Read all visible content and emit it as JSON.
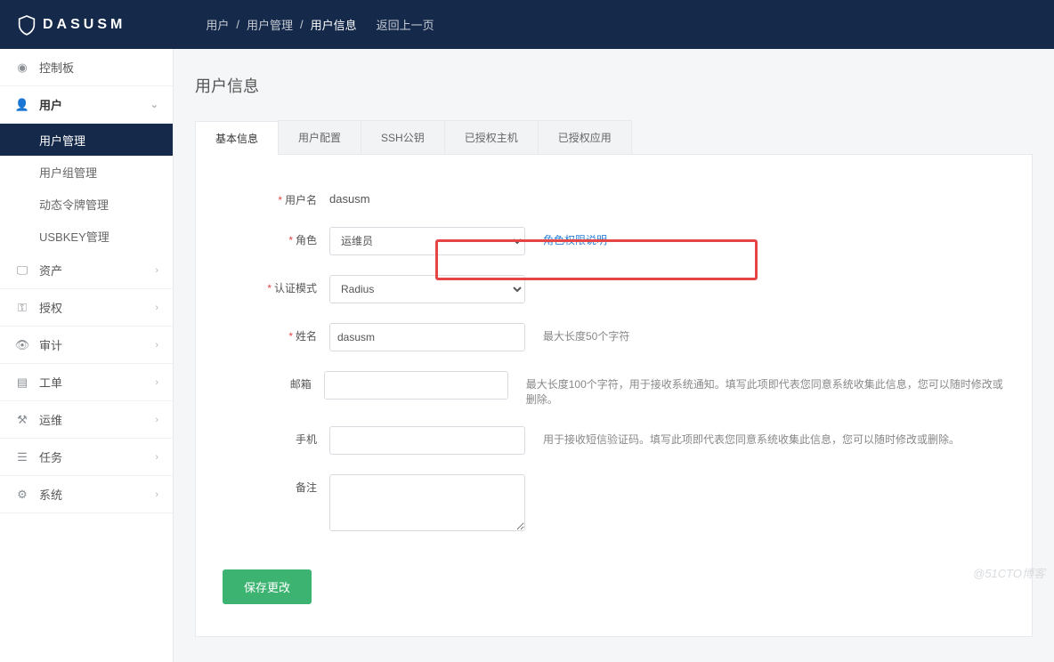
{
  "brand": "DASUSM",
  "breadcrumb": {
    "lvl1": "用户",
    "lvl2": "用户管理",
    "lvl3": "用户信息",
    "back": "返回上一页",
    "sep": "/"
  },
  "sidebar": {
    "items": [
      {
        "label": "控制板",
        "icon": "dashboard"
      },
      {
        "label": "用户",
        "icon": "user",
        "expanded": true,
        "chev": "⌄",
        "children": [
          {
            "label": "用户管理",
            "active": true
          },
          {
            "label": "用户组管理"
          },
          {
            "label": "动态令牌管理"
          },
          {
            "label": "USBKEY管理"
          }
        ]
      },
      {
        "label": "资产",
        "icon": "monitor",
        "chev": "›"
      },
      {
        "label": "授权",
        "icon": "key",
        "chev": "›"
      },
      {
        "label": "审计",
        "icon": "eye",
        "chev": "›"
      },
      {
        "label": "工单",
        "icon": "file",
        "chev": "›"
      },
      {
        "label": "运维",
        "icon": "ops",
        "chev": "›"
      },
      {
        "label": "任务",
        "icon": "task",
        "chev": "›"
      },
      {
        "label": "系统",
        "icon": "gear",
        "chev": "›"
      }
    ]
  },
  "page": {
    "title": "用户信息"
  },
  "tabs": [
    "基本信息",
    "用户配置",
    "SSH公钥",
    "已授权主机",
    "已授权应用"
  ],
  "form": {
    "username": {
      "label": "用户名",
      "value": "dasusm"
    },
    "role": {
      "label": "角色",
      "value": "运维员",
      "link": "角色权限说明"
    },
    "authmode": {
      "label": "认证模式",
      "value": "Radius"
    },
    "realname": {
      "label": "姓名",
      "value": "dasusm",
      "hint": "最大长度50个字符"
    },
    "email": {
      "label": "邮箱",
      "value": "",
      "hint": "最大长度100个字符，用于接收系统通知。填写此项即代表您同意系统收集此信息，您可以随时修改或删除。"
    },
    "phone": {
      "label": "手机",
      "value": "",
      "hint": "用于接收短信验证码。填写此项即代表您同意系统收集此信息，您可以随时修改或删除。"
    },
    "remark": {
      "label": "备注",
      "value": ""
    },
    "save": "保存更改"
  },
  "watermark": "@51CTO博客"
}
